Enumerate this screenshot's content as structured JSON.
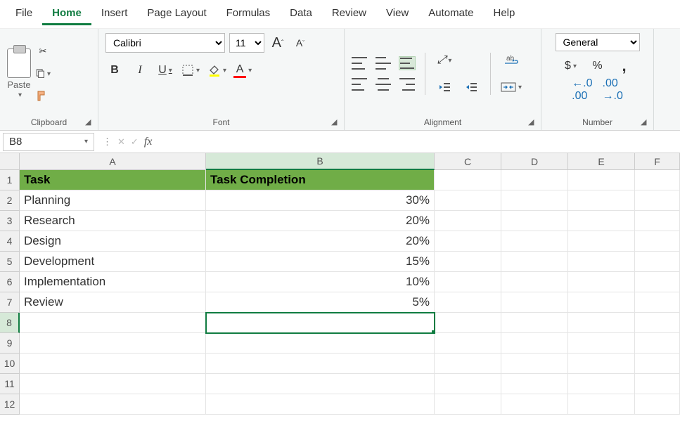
{
  "menu": {
    "items": [
      "File",
      "Home",
      "Insert",
      "Page Layout",
      "Formulas",
      "Data",
      "Review",
      "View",
      "Automate",
      "Help"
    ],
    "active": "Home"
  },
  "ribbon": {
    "clipboard": {
      "label": "Clipboard",
      "paste": "Paste"
    },
    "font": {
      "label": "Font",
      "name": "Calibri",
      "size": "11",
      "bold": "B",
      "italic": "I",
      "underline": "U"
    },
    "alignment": {
      "label": "Alignment"
    },
    "number": {
      "label": "Number",
      "format": "General"
    }
  },
  "nameBox": "B8",
  "formula": "",
  "columns": [
    "A",
    "B",
    "C",
    "D",
    "E",
    "F"
  ],
  "rows": [
    "1",
    "2",
    "3",
    "4",
    "5",
    "6",
    "7",
    "8",
    "9",
    "10",
    "11",
    "12"
  ],
  "selectedCell": "B8",
  "sheet": {
    "headerA": "Task",
    "headerB": "Task Completion",
    "data": [
      {
        "task": "Planning",
        "pct": "30%"
      },
      {
        "task": "Research",
        "pct": "20%"
      },
      {
        "task": "Design",
        "pct": "20%"
      },
      {
        "task": "Development",
        "pct": "15%"
      },
      {
        "task": "Implementation",
        "pct": "10%"
      },
      {
        "task": "Review",
        "pct": "5%"
      }
    ]
  },
  "chart_data": {
    "type": "table",
    "title": "Task Completion",
    "categories": [
      "Planning",
      "Research",
      "Design",
      "Development",
      "Implementation",
      "Review"
    ],
    "values": [
      30,
      20,
      20,
      15,
      10,
      5
    ],
    "xlabel": "Task",
    "ylabel": "Task Completion (%)"
  }
}
